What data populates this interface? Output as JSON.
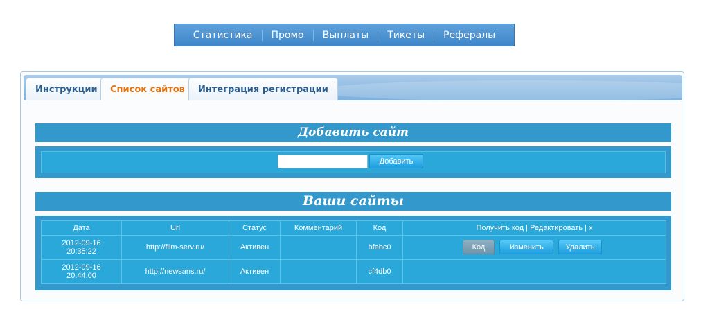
{
  "nav": {
    "items": [
      "Статистика",
      "Промо",
      "Выплаты",
      "Тикеты",
      "Рефералы"
    ]
  },
  "tabs": [
    {
      "label": "Инструкции",
      "active": false
    },
    {
      "label": "Список сайтов",
      "active": true
    },
    {
      "label": "Интеграция регистрации",
      "active": false
    }
  ],
  "add_site": {
    "title": "Добавить сайт",
    "input_value": "",
    "button": "Добавить"
  },
  "your_sites": {
    "title": "Ваши сайты",
    "columns": [
      "Дата",
      "Url",
      "Статус",
      "Комментарий",
      "Код",
      "Получить код | Редактировать | x"
    ],
    "rows": [
      {
        "date": "2012-09-16 20:35:22",
        "url": "http://film-serv.ru/",
        "status": "Активен",
        "comment": "",
        "code": "bfebc0",
        "actions": [
          "Код",
          "Изменить",
          "Удалить"
        ]
      },
      {
        "date": "2012-09-16 20:44:00",
        "url": "http://newsans.ru/",
        "status": "Активен",
        "comment": "",
        "code": "cf4db0",
        "actions": []
      }
    ]
  },
  "colors": {
    "header_blue": "#3398cc",
    "inner_blue": "#2aa8d9",
    "active_tab": "#e3720f",
    "nav_blue": "#4a8fd0"
  }
}
